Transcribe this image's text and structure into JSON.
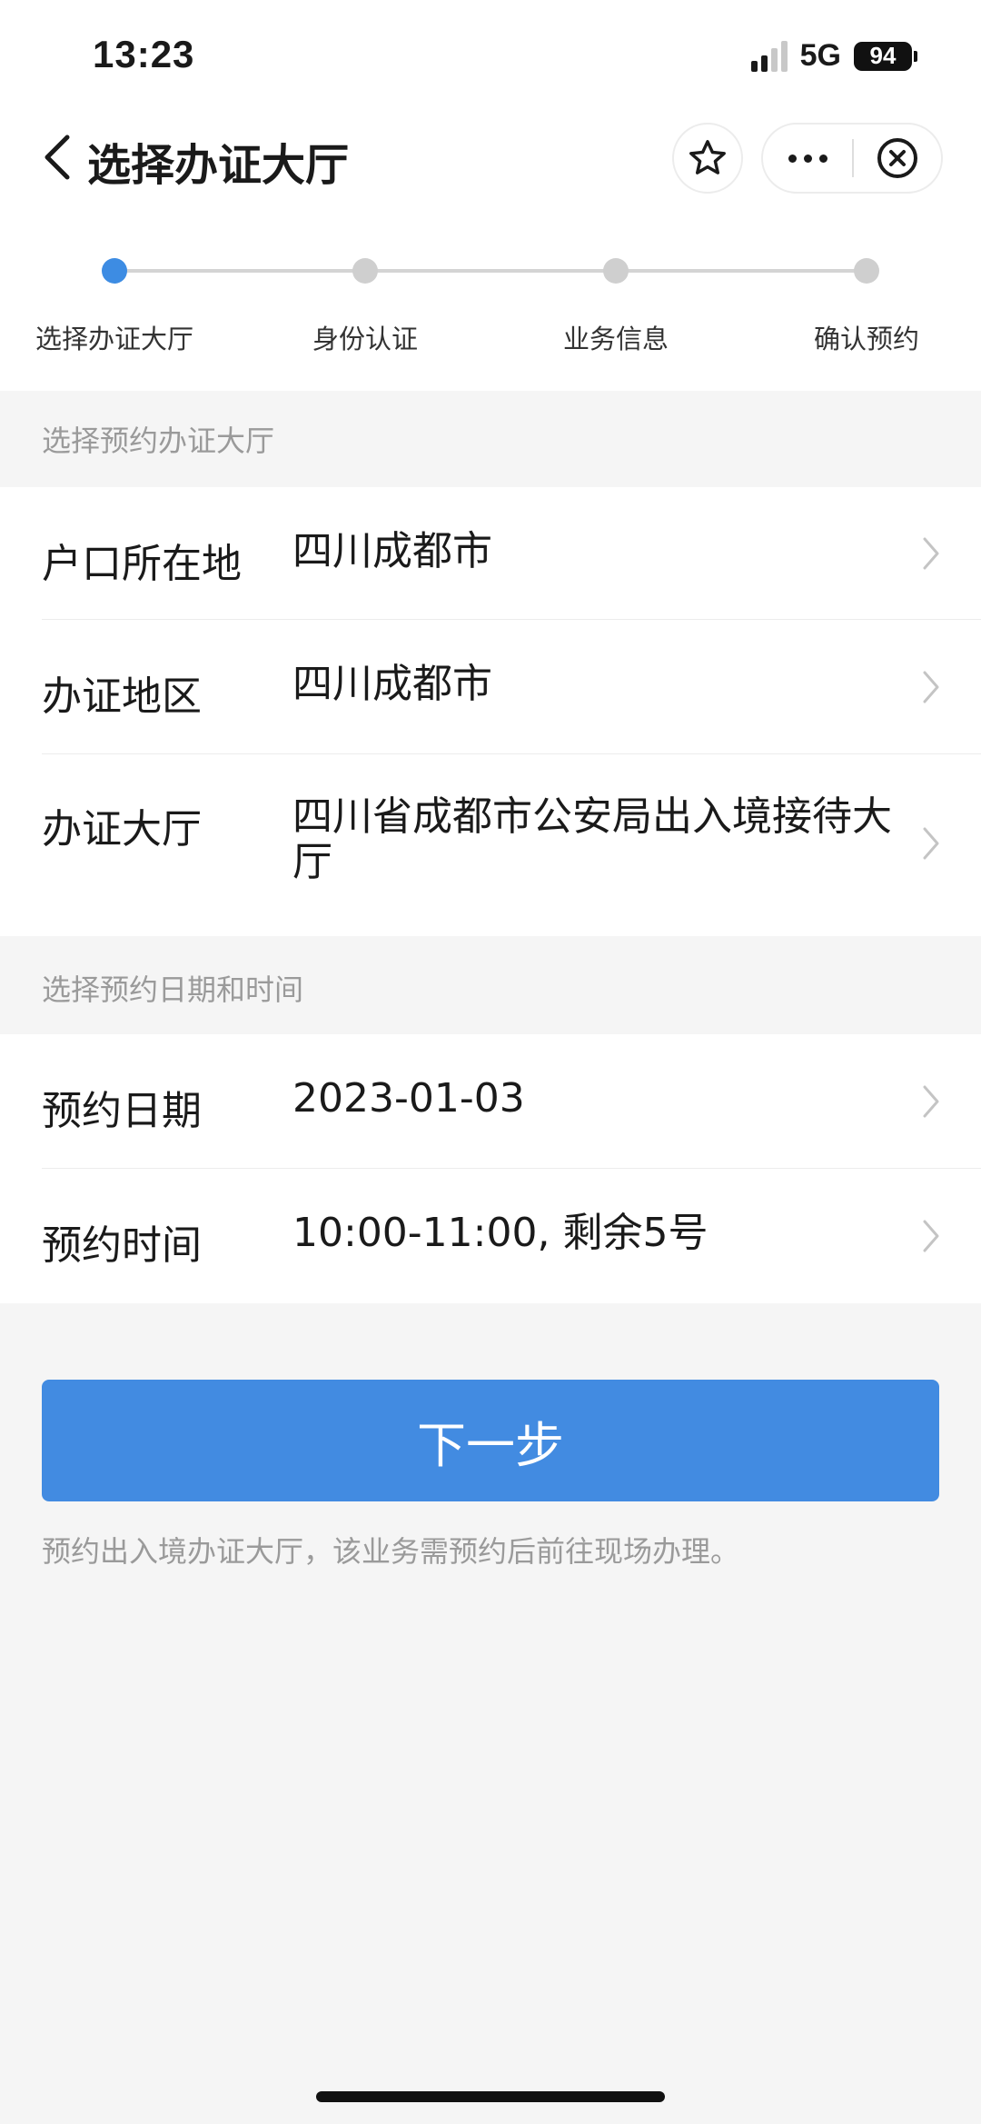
{
  "status_bar": {
    "time": "13:23",
    "network": "5G",
    "battery": "94"
  },
  "nav": {
    "title": "选择办证大厅"
  },
  "steps": [
    {
      "label": "选择办证大厅",
      "active": true
    },
    {
      "label": "身份认证",
      "active": false
    },
    {
      "label": "业务信息",
      "active": false
    },
    {
      "label": "确认预约",
      "active": false
    }
  ],
  "hall_section": {
    "header": "选择预约办证大厅",
    "rows": [
      {
        "label": "户口所在地",
        "value": "四川成都市"
      },
      {
        "label": "办证地区",
        "value": "四川成都市"
      },
      {
        "label": "办证大厅",
        "value": "四川省成都市公安局出入境接待大厅"
      }
    ]
  },
  "time_section": {
    "header": "选择预约日期和时间",
    "rows": [
      {
        "label": "预约日期",
        "value": "2023-01-03"
      },
      {
        "label": "预约时间",
        "value": "10:00-11:00, 剩余5号"
      }
    ]
  },
  "next_button": "下一步",
  "hint": "预约出入境办证大厅，该业务需预约后前往现场办理。",
  "colors": {
    "accent": "#428be1",
    "active_step": "#3d8ce3"
  }
}
